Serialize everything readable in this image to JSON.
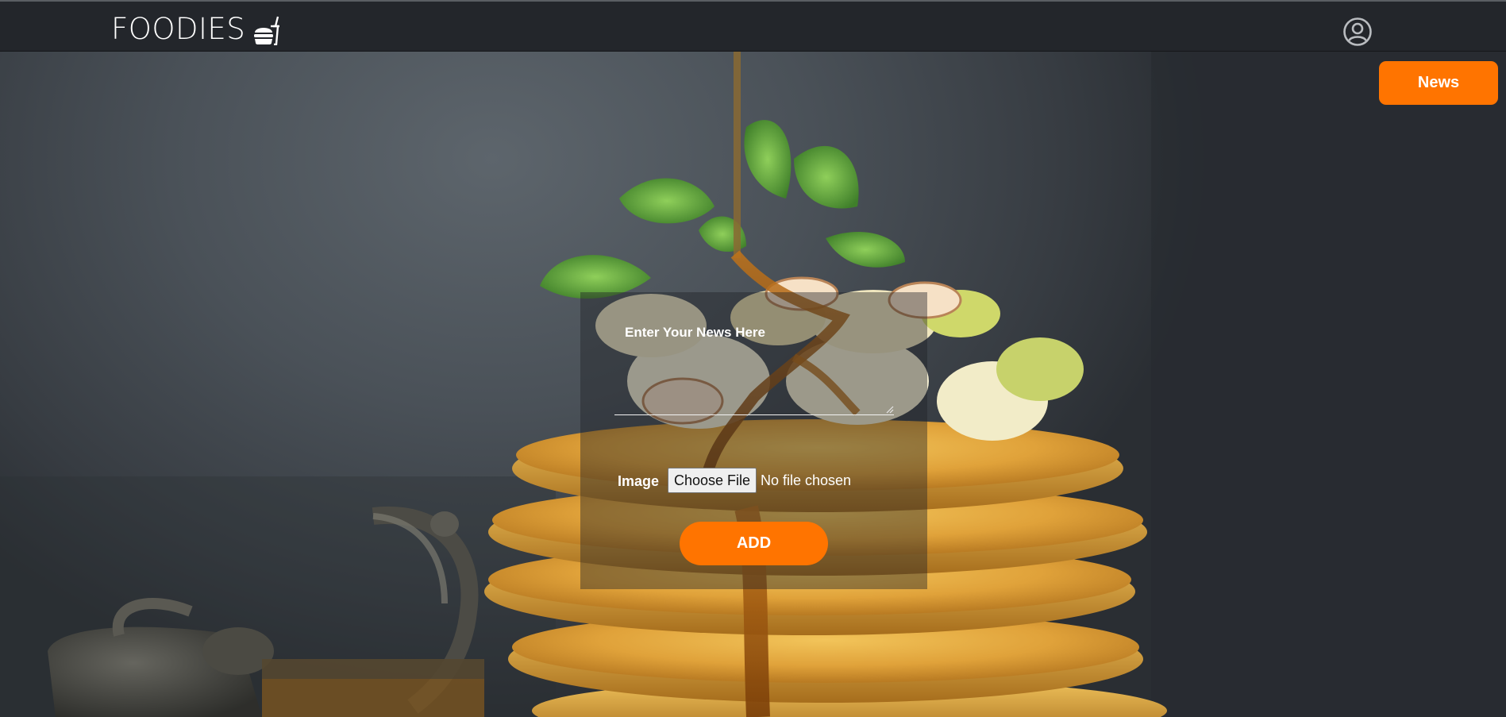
{
  "header": {
    "brand": "FOODIES",
    "brand_icon": "fast-food-icon",
    "user_icon": "user-circle-icon"
  },
  "news_button": {
    "label": "News"
  },
  "form": {
    "news_label": "Enter Your News Here",
    "news_value": "",
    "image_label": "Image",
    "file_button_label": "Choose File",
    "file_status": "No file chosen",
    "add_button_label": "ADD"
  },
  "colors": {
    "accent": "#ff7400",
    "topbar": "#23262b",
    "panel_overlay": "rgba(32,34,38,0.42)"
  }
}
